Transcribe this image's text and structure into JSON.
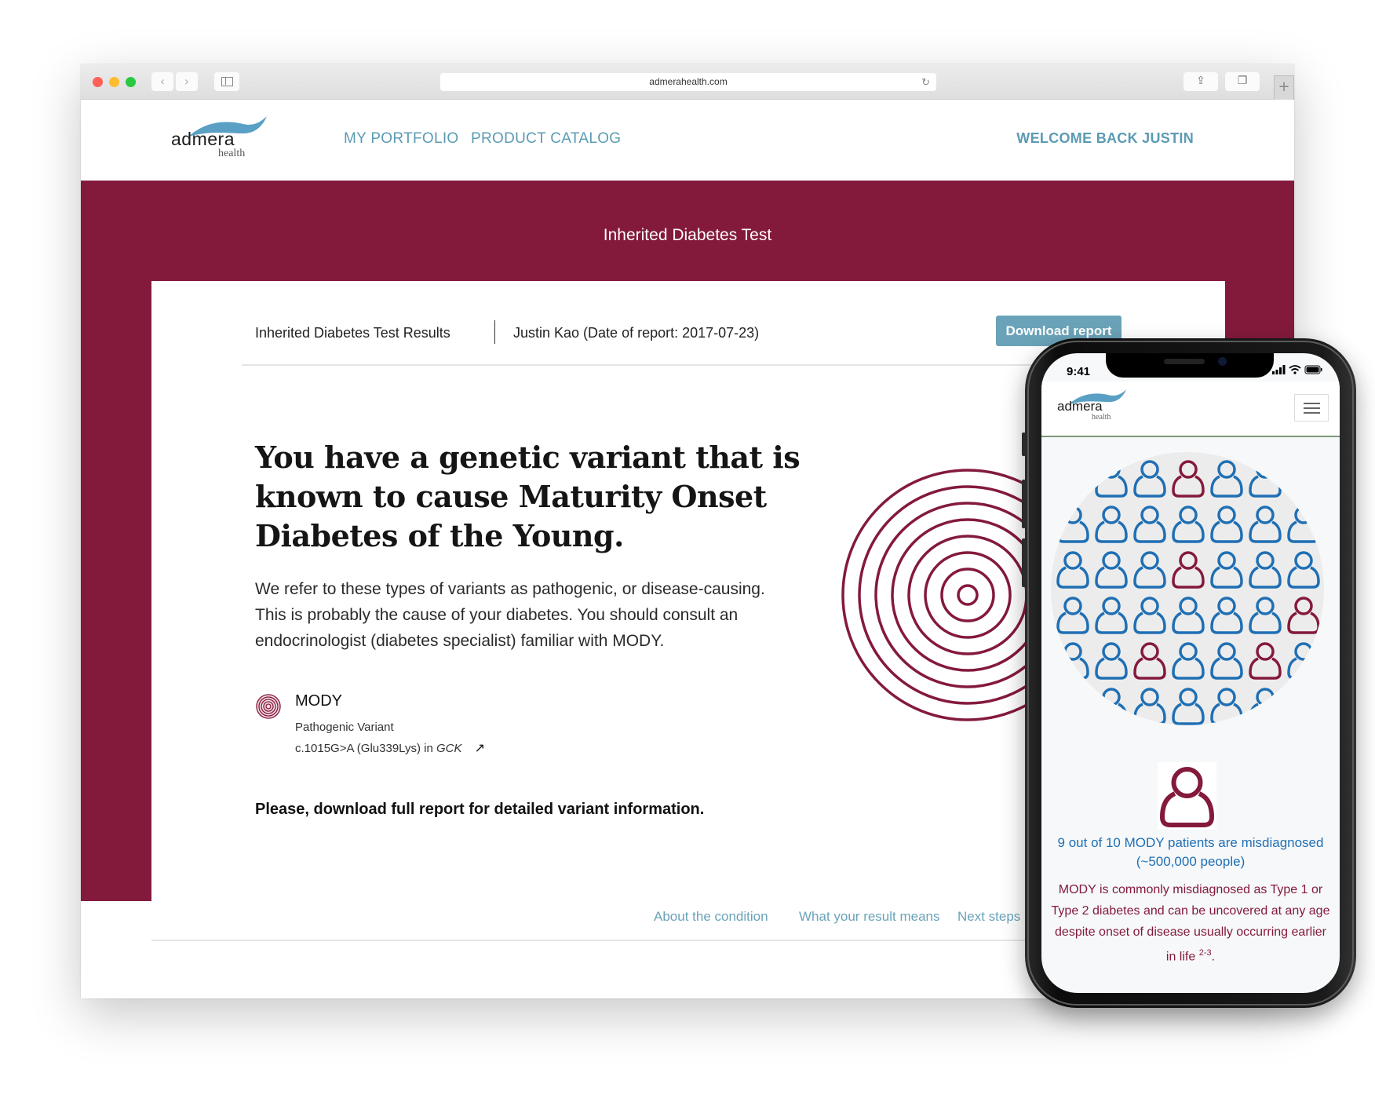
{
  "browser": {
    "url": "admerahealth.com",
    "icons": {
      "back": "chevron-left-icon",
      "forward": "chevron-right-icon",
      "sidebar": "sidebar-icon",
      "reload": "reload-icon",
      "share": "share-icon",
      "tabs": "tabs-icon",
      "new_tab": "plus-icon"
    },
    "glyphs": {
      "back": "‹",
      "forward": "›",
      "reload": "↻",
      "share": "⇪",
      "tabs": "❐",
      "new_tab": "+"
    }
  },
  "site": {
    "logo": {
      "word": "admera",
      "sub": "health"
    },
    "nav": {
      "portfolio": "MY PORTFOLIO",
      "catalog": "PRODUCT CATALOG",
      "welcome": "WELCOME BACK JUSTIN"
    },
    "hero_title": "Inherited Diabetes Test",
    "colors": {
      "brand": "#841a3b",
      "accent": "#6aa3b9",
      "link": "#5b9bb3",
      "mobile_blue": "#1f6fb4"
    }
  },
  "report": {
    "title": "Inherited Diabetes Test Results",
    "patient": "Justin Kao (Date of report: 2017-07-23)",
    "download_label": "Download report",
    "headline": "You have a genetic variant that is known to cause Maturity Onset Diabetes of the Young.",
    "intro": "We refer to these types of variants as pathogenic, or disease-causing. This is probably the cause of your diabetes. You should consult an endocrinologist (diabetes specialist) familiar with MODY.",
    "variant": {
      "icon": "target-icon",
      "name": "MODY",
      "classification": "Pathogenic Variant",
      "hgvs": "c.1015G>A (Glu339Lys) in ",
      "gene": "GCK",
      "link_icon": "external-link-icon",
      "link_glyph": "↗"
    },
    "cta": "Please, download full report for detailed variant information.",
    "subnav": [
      "About the condition",
      "What your result means",
      "Next steps"
    ]
  },
  "mobile": {
    "time": "9:41",
    "logo": {
      "word": "admera",
      "sub": "health"
    },
    "menu_icon": "hamburger-menu-icon",
    "stat": "9 out of 10 MODY patients are misdiagnosed (~500,000 people)",
    "description": "MODY is commonly misdiagnosed as Type 1 or Type 2 diabetes and can be uncovered at any age despite onset of disease usually occurring earlier in life",
    "citation": "2-3",
    "description_end": ".",
    "people_grid": {
      "rows": [
        [
          "blue",
          "blue",
          "blue",
          "red",
          "blue",
          "blue",
          "blue"
        ],
        [
          "blue",
          "blue",
          "blue",
          "blue",
          "blue",
          "blue",
          "blue"
        ],
        [
          "blue",
          "blue",
          "blue",
          "red",
          "blue",
          "blue",
          "blue"
        ],
        [
          "blue",
          "blue",
          "blue",
          "blue",
          "blue",
          "blue",
          "red"
        ],
        [
          "blue",
          "blue",
          "red",
          "blue",
          "blue",
          "red",
          "blue"
        ],
        [
          "blue",
          "blue",
          "blue",
          "blue",
          "blue",
          "blue",
          "blue"
        ]
      ]
    }
  }
}
